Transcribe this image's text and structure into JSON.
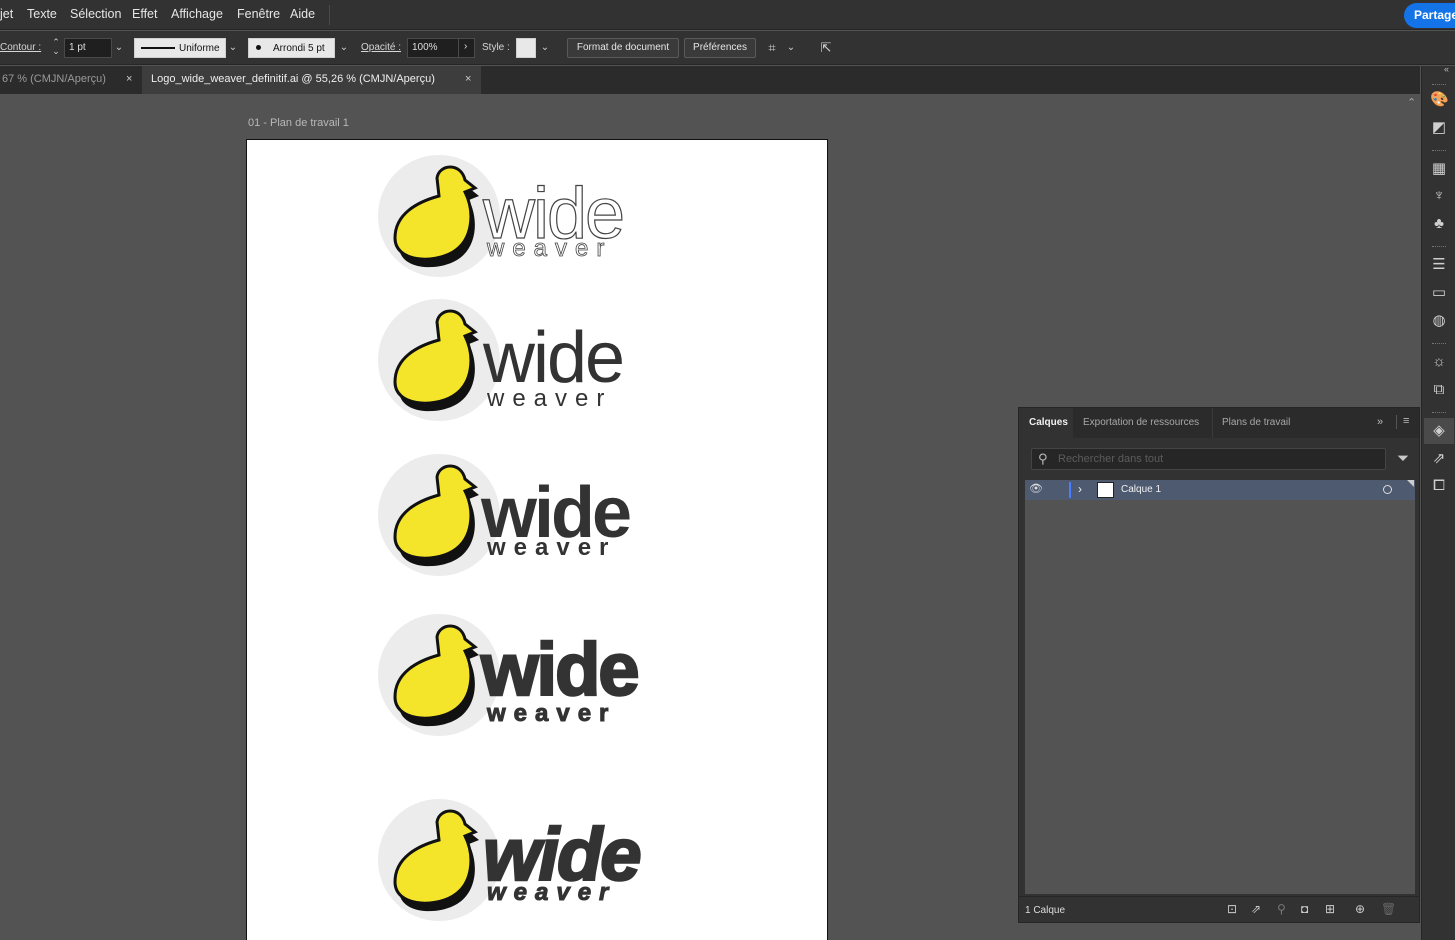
{
  "menubar": {
    "items": [
      "jet",
      "Texte",
      "Sélection",
      "Effet",
      "Affichage",
      "Fenêtre",
      "Aide"
    ],
    "share_label": "Partager"
  },
  "controlbar": {
    "contour_label": "Contour :",
    "stroke_weight": "1 pt",
    "stroke_profile": "Uniforme",
    "brush": "Arrondi 5 pt",
    "opacity_label": "Opacité :",
    "opacity_value": "100%",
    "style_label": "Style :",
    "doc_format_label": "Format de document",
    "prefs_label": "Préférences"
  },
  "tabs": [
    {
      "label": "67 % (CMJN/Aperçu)",
      "active": false
    },
    {
      "label": "Logo_wide_weaver_definitif.ai @ 55,26 % (CMJN/Aperçu)",
      "active": true
    }
  ],
  "artboard": {
    "label": "01 - Plan de travail 1",
    "logo_word_top": "wide",
    "logo_word_bottom": "weaver"
  },
  "layers_panel": {
    "tabs": [
      "Calques",
      "Exportation de ressources",
      "Plans de travail"
    ],
    "search_placeholder": "Rechercher dans tout",
    "layers": [
      {
        "name": "Calque 1"
      }
    ],
    "footer_count": "1 Calque"
  },
  "colors": {
    "accent": "#1473e6",
    "duck_yellow": "#f5e52a",
    "logo_text": "#333333",
    "circle_bg": "#ececec"
  }
}
